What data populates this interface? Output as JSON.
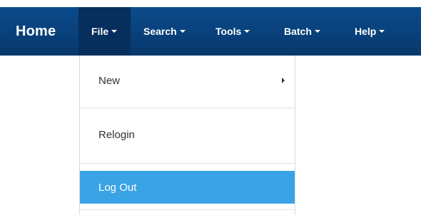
{
  "navbar": {
    "brand": "Home",
    "items": [
      {
        "label": "File"
      },
      {
        "label": "Search"
      },
      {
        "label": "Tools"
      },
      {
        "label": "Batch"
      },
      {
        "label": "Help"
      }
    ]
  },
  "file_menu": {
    "items": [
      {
        "label": "New"
      },
      {
        "label": "Relogin"
      },
      {
        "label": "Log Out"
      }
    ]
  },
  "colors": {
    "navbar": "#0b4b8c",
    "active_nav": "#062f5d",
    "highlight": "#3aa3e6"
  }
}
